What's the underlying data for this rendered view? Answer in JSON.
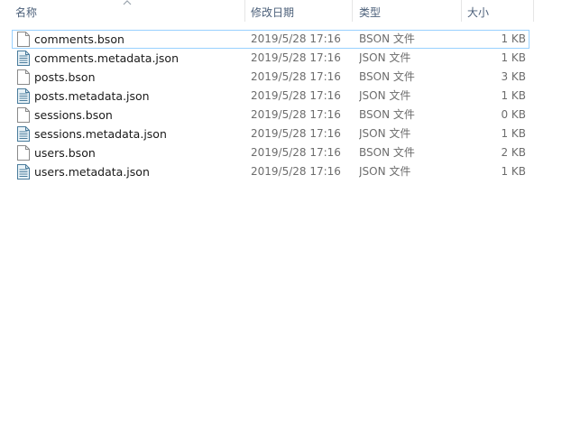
{
  "columns": {
    "name": "名称",
    "date": "修改日期",
    "type": "类型",
    "size": "大小"
  },
  "files": [
    {
      "name": "comments.bson",
      "date": "2019/5/28 17:16",
      "type": "BSON 文件",
      "size": "1 KB",
      "icon": "blank-file-icon"
    },
    {
      "name": "comments.metadata.json",
      "date": "2019/5/28 17:16",
      "type": "JSON 文件",
      "size": "1 KB",
      "icon": "text-file-icon"
    },
    {
      "name": "posts.bson",
      "date": "2019/5/28 17:16",
      "type": "BSON 文件",
      "size": "3 KB",
      "icon": "blank-file-icon"
    },
    {
      "name": "posts.metadata.json",
      "date": "2019/5/28 17:16",
      "type": "JSON 文件",
      "size": "1 KB",
      "icon": "text-file-icon"
    },
    {
      "name": "sessions.bson",
      "date": "2019/5/28 17:16",
      "type": "BSON 文件",
      "size": "0 KB",
      "icon": "blank-file-icon"
    },
    {
      "name": "sessions.metadata.json",
      "date": "2019/5/28 17:16",
      "type": "JSON 文件",
      "size": "1 KB",
      "icon": "text-file-icon"
    },
    {
      "name": "users.bson",
      "date": "2019/5/28 17:16",
      "type": "BSON 文件",
      "size": "2 KB",
      "icon": "blank-file-icon"
    },
    {
      "name": "users.metadata.json",
      "date": "2019/5/28 17:16",
      "type": "JSON 文件",
      "size": "1 KB",
      "icon": "text-file-icon"
    }
  ],
  "colors": {
    "header_text": "#4c607a",
    "focus_border": "#99d1ff",
    "detail_text": "#6d6d6d"
  }
}
